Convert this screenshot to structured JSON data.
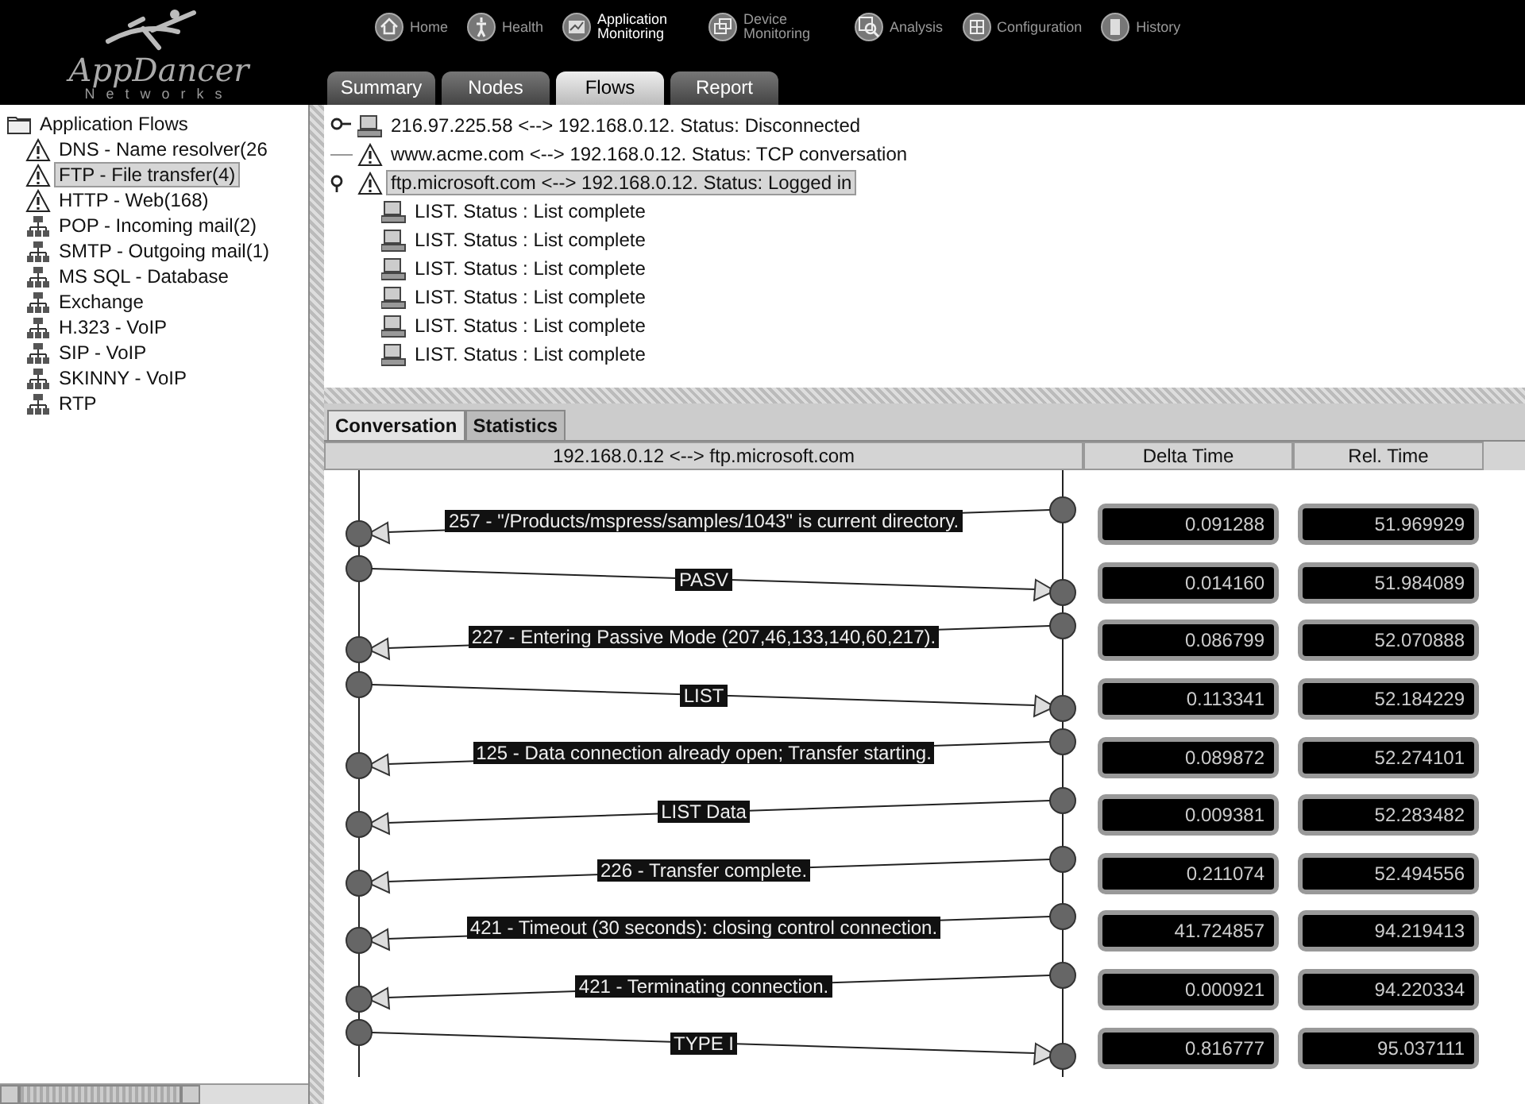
{
  "logo": {
    "name": "AppDancer",
    "tagline": "Networks"
  },
  "nav": [
    {
      "label": "Home",
      "kind": "home",
      "selected": false
    },
    {
      "label": "Health",
      "kind": "health",
      "selected": false
    },
    {
      "label": "Application Monitoring",
      "kind": "app",
      "selected": true
    },
    {
      "label": "Device Monitoring",
      "kind": "device",
      "selected": false
    },
    {
      "label": "Analysis",
      "kind": "analysis",
      "selected": false
    },
    {
      "label": "Configuration",
      "kind": "config",
      "selected": false
    },
    {
      "label": "History",
      "kind": "history",
      "selected": false
    }
  ],
  "tabs": [
    {
      "label": "Summary",
      "selected": false
    },
    {
      "label": "Nodes",
      "selected": false
    },
    {
      "label": "Flows",
      "selected": true
    },
    {
      "label": "Report",
      "selected": false
    }
  ],
  "sidebar": {
    "root": "Application Flows",
    "items": [
      {
        "label": "DNS - Name resolver(26",
        "kind": "warning",
        "selected": false
      },
      {
        "label": "FTP - File transfer(4)",
        "kind": "warning",
        "selected": true
      },
      {
        "label": "HTTP - Web(168)",
        "kind": "warning",
        "selected": false
      },
      {
        "label": "POP - Incoming mail(2)",
        "kind": "network",
        "selected": false
      },
      {
        "label": "SMTP - Outgoing mail(1)",
        "kind": "network",
        "selected": false
      },
      {
        "label": "MS SQL - Database",
        "kind": "network",
        "selected": false
      },
      {
        "label": "Exchange",
        "kind": "network",
        "selected": false
      },
      {
        "label": "H.323 - VoIP",
        "kind": "network",
        "selected": false
      },
      {
        "label": "SIP - VoIP",
        "kind": "network",
        "selected": false
      },
      {
        "label": "SKINNY - VoIP",
        "kind": "network",
        "selected": false
      },
      {
        "label": "RTP",
        "kind": "network",
        "selected": false
      }
    ]
  },
  "flows": [
    {
      "label": "216.97.225.58 <--> 192.168.0.12. Status: Disconnected",
      "kind": "computer",
      "expanded": false,
      "selected": false
    },
    {
      "label": "www.acme.com <--> 192.168.0.12. Status: TCP conversation",
      "kind": "warning",
      "selected": false
    },
    {
      "label": "ftp.microsoft.com <--> 192.168.0.12. Status: Logged in",
      "kind": "warning",
      "expanded": true,
      "selected": true,
      "children": [
        {
          "label": "LIST. Status : List complete"
        },
        {
          "label": "LIST. Status : List complete"
        },
        {
          "label": "LIST. Status : List complete"
        },
        {
          "label": "LIST. Status : List complete"
        },
        {
          "label": "LIST. Status : List complete"
        },
        {
          "label": "LIST. Status : List complete"
        }
      ]
    }
  ],
  "detail_tabs": [
    {
      "label": "Conversation",
      "selected": true
    },
    {
      "label": "Statistics",
      "selected": false
    }
  ],
  "table": {
    "columns": [
      "192.168.0.12 <--> ftp.microsoft.com",
      "Delta Time",
      "Rel. Time"
    ],
    "rows": [
      {
        "message": "257 - \"/Products/mspress/samples/1043\" is current directory.",
        "kind": "response",
        "delta": "0.091288",
        "rel": "51.969929"
      },
      {
        "message": "PASV",
        "kind": "request",
        "delta": "0.014160",
        "rel": "51.984089"
      },
      {
        "message": "227 - Entering Passive Mode (207,46,133,140,60,217).",
        "kind": "response",
        "delta": "0.086799",
        "rel": "52.070888"
      },
      {
        "message": "LIST",
        "kind": "request",
        "delta": "0.113341",
        "rel": "52.184229"
      },
      {
        "message": "125 - Data connection already open; Transfer starting.",
        "kind": "response",
        "delta": "0.089872",
        "rel": "52.274101"
      },
      {
        "message": "LIST Data",
        "kind": "response",
        "delta": "0.009381",
        "rel": "52.283482"
      },
      {
        "message": "226 - Transfer complete.",
        "kind": "response",
        "delta": "0.211074",
        "rel": "52.494556"
      },
      {
        "message": "421 - Timeout (30 seconds): closing control connection.",
        "kind": "response",
        "delta": "41.724857",
        "rel": "94.219413"
      },
      {
        "message": "421 - Terminating connection.",
        "kind": "response",
        "delta": "0.000921",
        "rel": "94.220334"
      },
      {
        "message": "TYPE I",
        "kind": "request",
        "delta": "0.816777",
        "rel": "95.037111"
      }
    ]
  }
}
